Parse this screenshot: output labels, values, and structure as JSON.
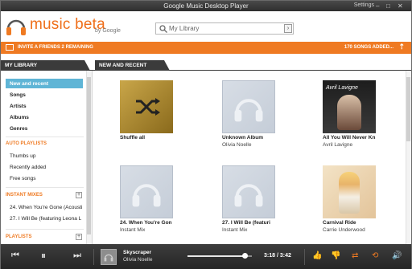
{
  "window": {
    "title": "Google Music Desktop Player",
    "settings_label": "Settings",
    "controls": [
      "‒",
      "□",
      "✕"
    ]
  },
  "header": {
    "logo_text": "music beta",
    "logo_by": "by Google",
    "search_placeholder": "My Library",
    "search_go": "›"
  },
  "banner": {
    "invite_text": "INVITE A FRIENDS 2 REMAINING",
    "songs_added": "170 SONGS ADDED..."
  },
  "tabs": {
    "left": "MY LIBRARY",
    "right": "NEW AND RECENT"
  },
  "sidebar": {
    "library": [
      "New and recent",
      "Songs",
      "Artists",
      "Albums",
      "Genres"
    ],
    "auto_playlists_heading": "AUTO PLAYLISTS",
    "auto_playlists": [
      "Thumbs up",
      "Recently added",
      "Free songs"
    ],
    "instant_mixes_heading": "INSTANT MIXES",
    "instant_mixes": [
      "24. When You're Gone (Acousti",
      "27. I Will Be (featuring Leona L"
    ],
    "playlists_heading": "PLAYLISTS",
    "plus_label": "+"
  },
  "albums": [
    {
      "title": "Shuffle all",
      "subtitle": "",
      "art": "shuffle"
    },
    {
      "title": "Unknown Album",
      "subtitle": "Olivia Noelle",
      "art": "headphones"
    },
    {
      "title": "All You Will Never Kn",
      "subtitle": "Avril Lavigne",
      "art": "avril"
    },
    {
      "title": "24. When You're Gon",
      "subtitle": "Instant Mix",
      "art": "headphones"
    },
    {
      "title": "27. I Will Be (featuri",
      "subtitle": "Instant Mix",
      "art": "headphones"
    },
    {
      "title": "Carnival Ride",
      "subtitle": "Carrie Underwood",
      "art": "carrie"
    }
  ],
  "art_text": {
    "avril": "Avril Lavigne"
  },
  "player": {
    "song": "Skyscraper",
    "artist": "Olivia Noelle",
    "time": "3:18 / 3:42",
    "progress": 0.89
  },
  "colors": {
    "accent": "#ef7a22",
    "selected": "#5fb5d6"
  }
}
